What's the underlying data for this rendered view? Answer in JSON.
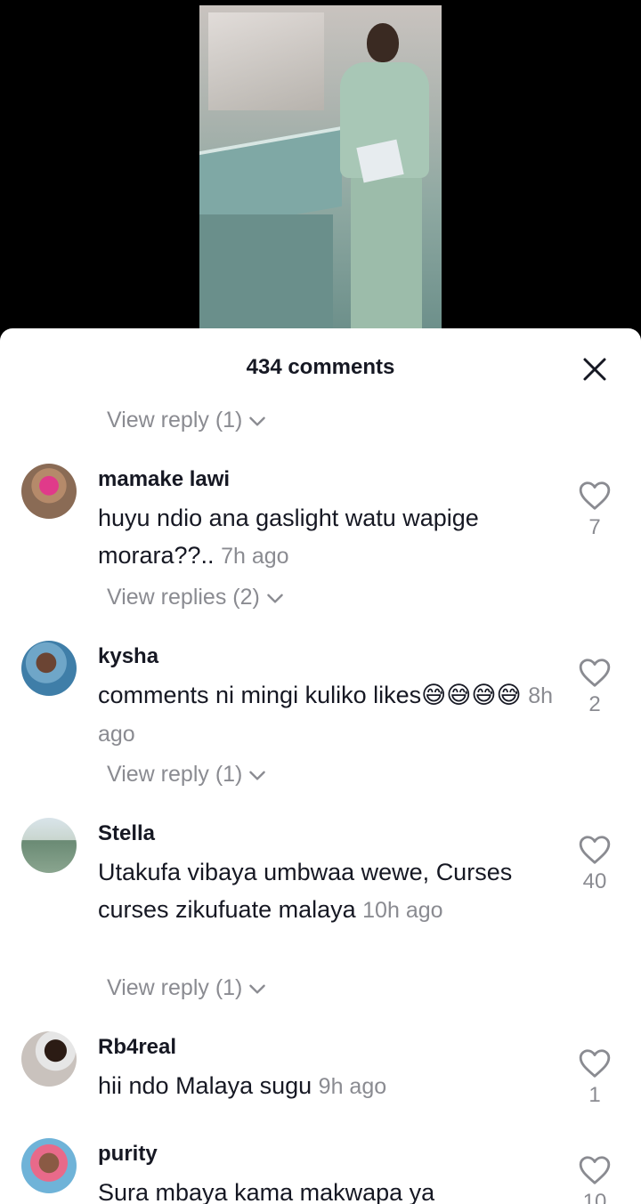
{
  "header": {
    "title": "434 comments"
  },
  "top_reply_link": {
    "label": "View reply (1)"
  },
  "comments": [
    {
      "username": "mamake lawi",
      "text": "huyu ndio ana gaslight watu wapige morara??..",
      "time": "7h ago",
      "likes": "7",
      "replies_label": "View replies (2)"
    },
    {
      "username": "kysha",
      "text": "comments ni mingi kuliko likes😅😅😅😅",
      "time": "8h ago",
      "likes": "2",
      "replies_label": "View reply (1)"
    },
    {
      "username": "Stella",
      "text": "Utakufa vibaya umbwaa wewe, Curses curses zikufuate malaya",
      "time": "10h ago",
      "likes": "40",
      "replies_label": "View reply (1)"
    },
    {
      "username": "Rb4real",
      "text": "hii ndo Malaya sugu",
      "time": "9h ago",
      "likes": "1"
    },
    {
      "username": "purity",
      "text": "Sura mbaya kama makwapa ya",
      "likes": "10"
    }
  ]
}
